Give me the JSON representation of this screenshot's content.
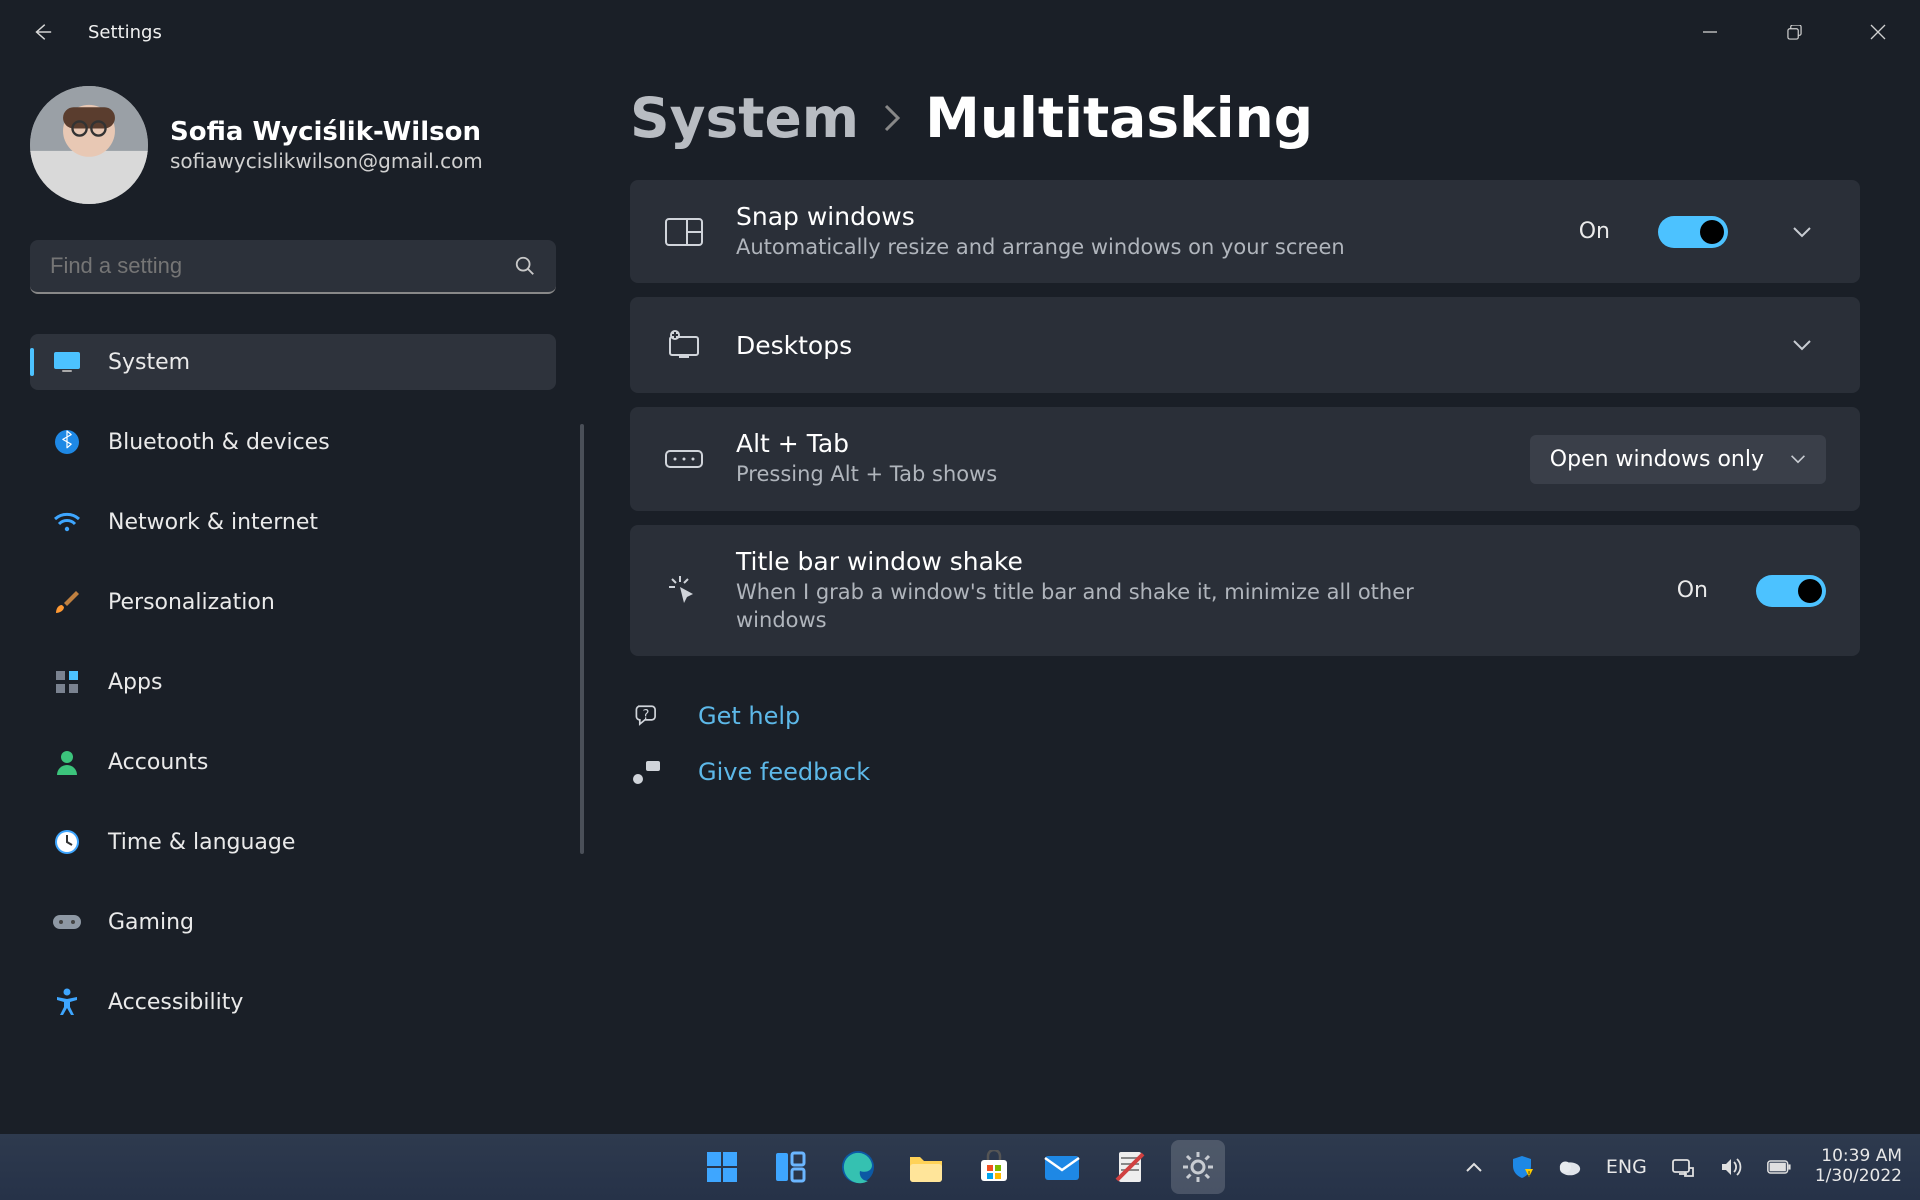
{
  "window": {
    "title": "Settings"
  },
  "profile": {
    "name": "Sofia Wyciślik-Wilson",
    "email": "sofiawycislikwilson@gmail.com"
  },
  "search": {
    "placeholder": "Find a setting"
  },
  "nav": [
    {
      "icon": "monitor-icon",
      "label": "System",
      "active": true
    },
    {
      "icon": "bluetooth-icon",
      "label": "Bluetooth & devices"
    },
    {
      "icon": "wifi-icon",
      "label": "Network & internet"
    },
    {
      "icon": "brush-icon",
      "label": "Personalization"
    },
    {
      "icon": "apps-icon",
      "label": "Apps"
    },
    {
      "icon": "person-icon",
      "label": "Accounts"
    },
    {
      "icon": "clock-icon",
      "label": "Time & language"
    },
    {
      "icon": "gamepad-icon",
      "label": "Gaming"
    },
    {
      "icon": "accessibility-icon",
      "label": "Accessibility"
    }
  ],
  "breadcrumb": {
    "parent": "System",
    "current": "Multitasking"
  },
  "settings": {
    "snap": {
      "title": "Snap windows",
      "sub": "Automatically resize and arrange windows on your screen",
      "state_label": "On",
      "on": true
    },
    "desktops": {
      "title": "Desktops"
    },
    "alttab": {
      "title": "Alt + Tab",
      "sub": "Pressing Alt + Tab shows",
      "dropdown_value": "Open windows only"
    },
    "shake": {
      "title": "Title bar window shake",
      "sub": "When I grab a window's title bar and shake it, minimize all other windows",
      "state_label": "On",
      "on": true
    }
  },
  "links": {
    "help": "Get help",
    "feedback": "Give feedback"
  },
  "systray": {
    "lang": "ENG",
    "time": "10:39 AM",
    "date": "1/30/2022"
  }
}
